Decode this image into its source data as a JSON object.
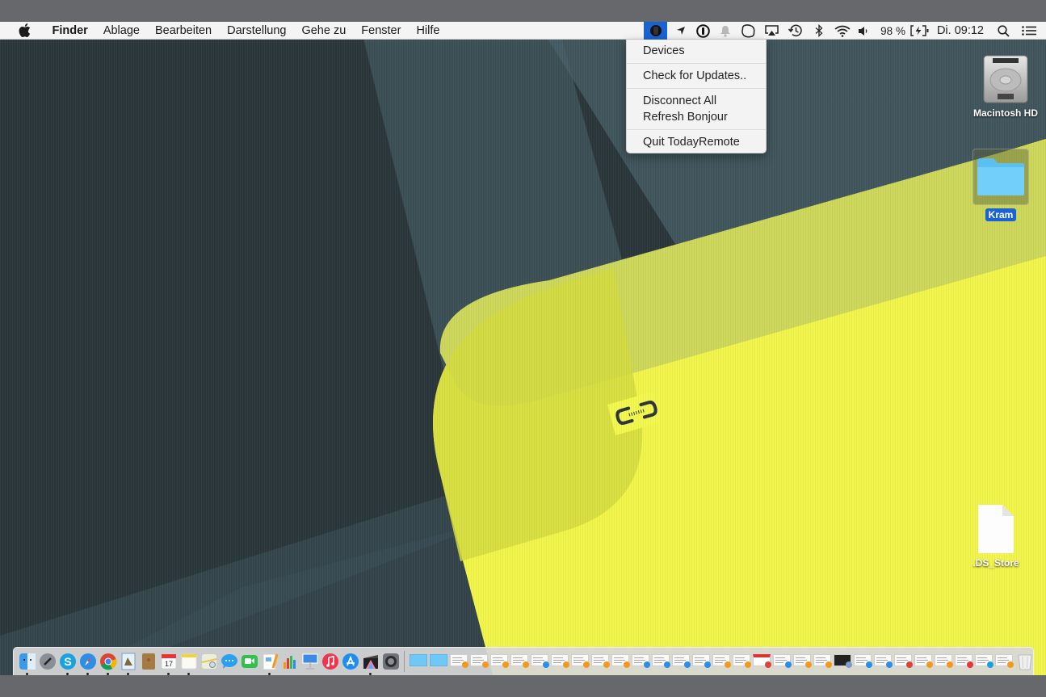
{
  "menubar": {
    "apple_icon": "apple-logo",
    "app_name": "Finder",
    "menus": [
      "Ablage",
      "Bearbeiten",
      "Darstellung",
      "Gehe zu",
      "Fenster",
      "Hilfe"
    ],
    "status_items": [
      {
        "name": "todayremote-icon",
        "active": true
      },
      {
        "name": "location-arrow-icon"
      },
      {
        "name": "1password-icon"
      },
      {
        "name": "notification-bell-icon"
      },
      {
        "name": "skype-icon"
      },
      {
        "name": "airplay-icon"
      },
      {
        "name": "time-machine-icon"
      },
      {
        "name": "bluetooth-icon"
      },
      {
        "name": "wifi-icon"
      },
      {
        "name": "volume-icon"
      }
    ],
    "battery_percent": "98 %",
    "battery_charging": true,
    "clock": "Di. 09:12",
    "spotlight_icon": "search-icon",
    "notification_center_icon": "list-icon",
    "active_color": "#1a63d5"
  },
  "dropdown": {
    "app": "TodayRemote",
    "groups": [
      [
        "Devices"
      ],
      [
        "Check for Updates.."
      ],
      [
        "Disconnect All",
        "Refresh Bonjour"
      ],
      [
        "Quit TodayRemote"
      ]
    ]
  },
  "desktop": {
    "icons": [
      {
        "label": "Macintosh HD",
        "type": "hard-drive",
        "selected": false
      },
      {
        "label": "Kram",
        "type": "folder",
        "selected": true
      },
      {
        "label": ".DS_Store",
        "type": "file",
        "selected": false
      }
    ],
    "wallpaper_colors": {
      "dark": "#2b363b",
      "mid": "#3e535b",
      "light": "#4e6670",
      "yellow": "#f2f54a",
      "olive": "#cdd75a"
    }
  },
  "dock": {
    "apps": [
      {
        "name": "Finder",
        "running": true
      },
      {
        "name": "Launchpad",
        "running": false
      },
      {
        "name": "Skype",
        "running": true
      },
      {
        "name": "Safari",
        "running": true
      },
      {
        "name": "Chrome",
        "running": true
      },
      {
        "name": "Preview",
        "running": true
      },
      {
        "name": "Contacts",
        "running": false
      },
      {
        "name": "Calendar",
        "running": true,
        "text": "17"
      },
      {
        "name": "Notes",
        "running": true
      },
      {
        "name": "Maps",
        "running": false
      },
      {
        "name": "Messages",
        "running": false
      },
      {
        "name": "FaceTime",
        "running": false
      },
      {
        "name": "Pages",
        "running": true
      },
      {
        "name": "Numbers",
        "running": false
      },
      {
        "name": "Keynote",
        "running": false
      },
      {
        "name": "iTunes",
        "running": false
      },
      {
        "name": "App Store",
        "running": false
      },
      {
        "name": "Final Cut Pro",
        "running": true
      },
      {
        "name": "System Preferences",
        "running": false
      }
    ],
    "minimized_windows": [
      {
        "badge": "appstore"
      },
      {
        "badge": "appstore"
      },
      {
        "badge": "pages"
      },
      {
        "badge": "pages"
      },
      {
        "badge": "pages"
      },
      {
        "badge": "pages"
      },
      {
        "badge": "finder"
      },
      {
        "badge": "pages"
      },
      {
        "badge": "pages"
      },
      {
        "badge": "pages"
      },
      {
        "badge": "pages"
      },
      {
        "badge": "finder"
      },
      {
        "badge": "finder"
      },
      {
        "badge": "finder"
      },
      {
        "badge": "finder"
      },
      {
        "badge": "pages"
      },
      {
        "badge": "pages"
      },
      {
        "badge": "chrome"
      },
      {
        "badge": "finder"
      },
      {
        "badge": "pages"
      },
      {
        "badge": "pages"
      },
      {
        "badge": "preview"
      },
      {
        "badge": "finder"
      },
      {
        "badge": "safari"
      },
      {
        "badge": "chrome"
      },
      {
        "badge": "pages"
      },
      {
        "badge": "pages"
      },
      {
        "badge": "calendar"
      },
      {
        "badge": "skype"
      },
      {
        "badge": "pages"
      }
    ],
    "trash": "Trash"
  }
}
